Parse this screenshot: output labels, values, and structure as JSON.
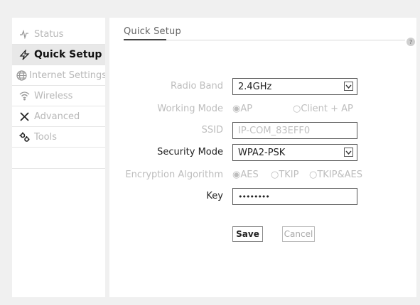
{
  "sidebar": {
    "items": [
      {
        "label": "Status",
        "icon": "pulse-icon",
        "state": "dim"
      },
      {
        "label": "Quick Setup",
        "icon": "lightning-icon",
        "state": "active"
      },
      {
        "label": "Internet Settings",
        "icon": "globe-icon",
        "state": "dim"
      },
      {
        "label": "Wireless",
        "icon": "wifi-icon",
        "state": "dim"
      },
      {
        "label": "Advanced",
        "icon": "tools-cross-icon",
        "state": "dim"
      },
      {
        "label": "Tools",
        "icon": "gears-icon",
        "state": "dim"
      }
    ]
  },
  "main": {
    "title": "Quick Setup",
    "help_label": "?",
    "form": {
      "radio_band": {
        "label": "Radio Band",
        "value": "2.4GHz"
      },
      "working_mode": {
        "label": "Working Mode",
        "options": [
          "AP",
          "Client + AP"
        ],
        "selected": "AP"
      },
      "ssid": {
        "label": "SSID",
        "value": "IP-COM_83EFF0"
      },
      "security_mode": {
        "label": "Security Mode",
        "value": "WPA2-PSK"
      },
      "encryption": {
        "label": "Encryption Algorithm",
        "options": [
          "AES",
          "TKIP",
          "TKIP&AES"
        ],
        "selected": "AES"
      },
      "key": {
        "label": "Key",
        "value": "••••••••"
      }
    },
    "buttons": {
      "save": "Save",
      "cancel": "Cancel"
    }
  },
  "colors": {
    "background": "#f0f0f0",
    "panel": "#ffffff",
    "active_nav": "#e8e8e8",
    "disabled_text": "#bdbdbd"
  }
}
